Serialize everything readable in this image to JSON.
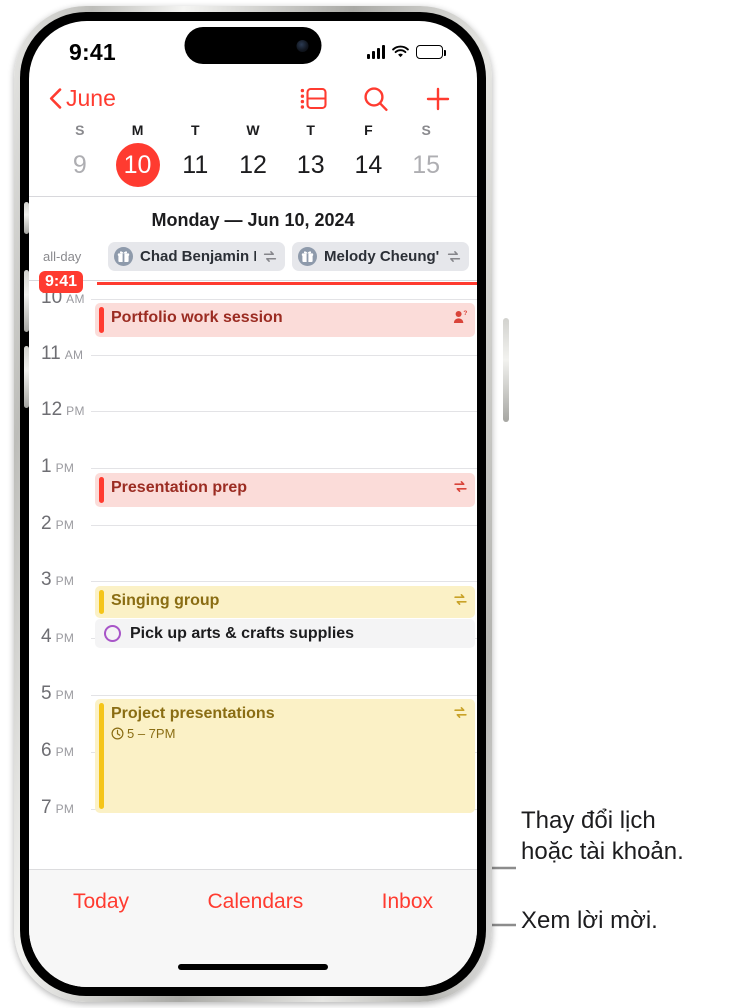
{
  "status_bar": {
    "time": "9:41",
    "cellular_icon": "cellular-bars-icon",
    "wifi_icon": "wifi-icon",
    "battery_icon": "battery-icon"
  },
  "nav_bar": {
    "back_label": "June",
    "back_icon": "chevron-left-icon",
    "actions": [
      {
        "icon": "day-list-view-icon"
      },
      {
        "icon": "search-icon"
      },
      {
        "icon": "add-event-icon"
      }
    ]
  },
  "week_strip": {
    "weekdays": [
      "S",
      "M",
      "T",
      "W",
      "T",
      "F",
      "S"
    ],
    "dates": [
      {
        "num": "9",
        "state": "dim"
      },
      {
        "num": "10",
        "state": "today"
      },
      {
        "num": "11",
        "state": "normal"
      },
      {
        "num": "12",
        "state": "normal"
      },
      {
        "num": "13",
        "state": "normal"
      },
      {
        "num": "14",
        "state": "normal"
      },
      {
        "num": "15",
        "state": "dim"
      }
    ]
  },
  "day_header": "Monday — Jun 10, 2024",
  "all_day": {
    "label": "all-day",
    "events": [
      {
        "title": "Chad Benjamin P...",
        "icon": "gift-icon",
        "repeat_icon": "repeat-icon"
      },
      {
        "title": "Melody Cheung's...",
        "icon": "gift-icon",
        "repeat_icon": "repeat-icon"
      }
    ]
  },
  "timeline": {
    "now": {
      "time": "9:41",
      "label": "current-time-indicator"
    },
    "hours": [
      {
        "num": "10",
        "suffix": "AM"
      },
      {
        "num": "11",
        "suffix": "AM"
      },
      {
        "num": "12",
        "suffix": "PM"
      },
      {
        "num": "1",
        "suffix": "PM"
      },
      {
        "num": "2",
        "suffix": "PM"
      },
      {
        "num": "3",
        "suffix": "PM"
      },
      {
        "num": "4",
        "suffix": "PM"
      },
      {
        "num": "5",
        "suffix": "PM"
      },
      {
        "num": "6",
        "suffix": "PM"
      },
      {
        "num": "7",
        "suffix": "PM"
      }
    ],
    "events": [
      {
        "title": "Portfolio work session",
        "color": "red",
        "badge": "person-question-icon",
        "time": ""
      },
      {
        "title": "Presentation prep",
        "color": "red",
        "badge": "repeat-icon",
        "time": ""
      },
      {
        "title": "Singing group",
        "color": "yellow",
        "badge": "repeat-icon",
        "time": ""
      },
      {
        "title": "Project presentations",
        "color": "yellow",
        "badge": "repeat-icon",
        "time": "5 – 7PM",
        "time_icon": "clock-icon"
      }
    ],
    "reminders": [
      {
        "title": "Pick up arts & crafts supplies",
        "icon": "reminder-circle-icon"
      }
    ]
  },
  "bottom_toolbar": {
    "today_label": "Today",
    "calendars_label": "Calendars",
    "inbox_label": "Inbox"
  },
  "callouts": {
    "calendars": "Thay đổi lịch\nhoặc tài khoản.",
    "inbox": "Xem lời mời."
  },
  "colors": {
    "accent_red": "#FF3B30",
    "event_red_bg": "#FBDCD9",
    "event_red_text": "#9B2C22",
    "event_yellow_bg": "#FBF1C6",
    "event_yellow_bar": "#F5C518",
    "event_yellow_text": "#8A6D13",
    "reminder_purple": "#A855C8"
  }
}
